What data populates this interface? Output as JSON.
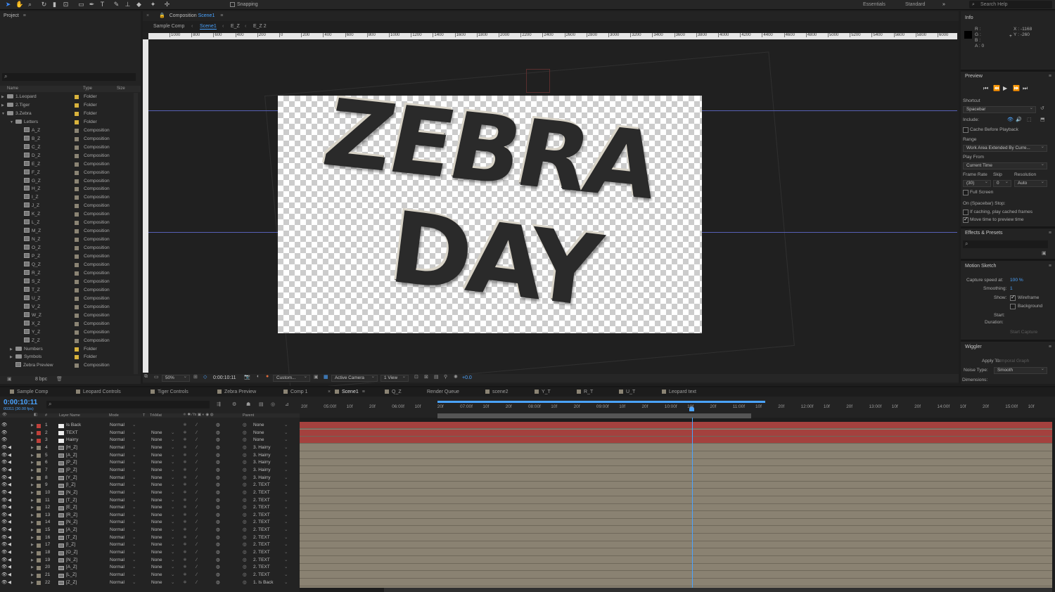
{
  "toolbar": {
    "snapping_label": "Snapping",
    "workspaces": [
      "Essentials",
      "Standard"
    ],
    "search_placeholder": "Search Help"
  },
  "project": {
    "title": "Project",
    "bpc": "8 bpc",
    "columns": {
      "name": "Name",
      "type": "Type",
      "size": "Size"
    },
    "items": [
      {
        "name": "1.Leopard",
        "type": "Folder",
        "level": 0,
        "kind": "folder",
        "open": false
      },
      {
        "name": "2.Tiger",
        "type": "Folder",
        "level": 0,
        "kind": "folder",
        "open": false
      },
      {
        "name": "3.Zebra",
        "type": "Folder",
        "level": 0,
        "kind": "folder",
        "open": true
      },
      {
        "name": "Letters",
        "type": "Folder",
        "level": 1,
        "kind": "folder",
        "open": true
      },
      {
        "name": "A_Z",
        "type": "Composition",
        "level": 2,
        "kind": "comp"
      },
      {
        "name": "B_Z",
        "type": "Composition",
        "level": 2,
        "kind": "comp"
      },
      {
        "name": "C_Z",
        "type": "Composition",
        "level": 2,
        "kind": "comp"
      },
      {
        "name": "D_Z",
        "type": "Composition",
        "level": 2,
        "kind": "comp"
      },
      {
        "name": "E_Z",
        "type": "Composition",
        "level": 2,
        "kind": "comp"
      },
      {
        "name": "F_Z",
        "type": "Composition",
        "level": 2,
        "kind": "comp"
      },
      {
        "name": "G_Z",
        "type": "Composition",
        "level": 2,
        "kind": "comp"
      },
      {
        "name": "H_Z",
        "type": "Composition",
        "level": 2,
        "kind": "comp"
      },
      {
        "name": "I_Z",
        "type": "Composition",
        "level": 2,
        "kind": "comp"
      },
      {
        "name": "J_Z",
        "type": "Composition",
        "level": 2,
        "kind": "comp"
      },
      {
        "name": "K_Z",
        "type": "Composition",
        "level": 2,
        "kind": "comp"
      },
      {
        "name": "L_Z",
        "type": "Composition",
        "level": 2,
        "kind": "comp"
      },
      {
        "name": "M_Z",
        "type": "Composition",
        "level": 2,
        "kind": "comp"
      },
      {
        "name": "N_Z",
        "type": "Composition",
        "level": 2,
        "kind": "comp"
      },
      {
        "name": "O_Z",
        "type": "Composition",
        "level": 2,
        "kind": "comp"
      },
      {
        "name": "P_Z",
        "type": "Composition",
        "level": 2,
        "kind": "comp"
      },
      {
        "name": "Q_Z",
        "type": "Composition",
        "level": 2,
        "kind": "comp"
      },
      {
        "name": "R_Z",
        "type": "Composition",
        "level": 2,
        "kind": "comp"
      },
      {
        "name": "S_Z",
        "type": "Composition",
        "level": 2,
        "kind": "comp"
      },
      {
        "name": "T_Z",
        "type": "Composition",
        "level": 2,
        "kind": "comp"
      },
      {
        "name": "U_Z",
        "type": "Composition",
        "level": 2,
        "kind": "comp"
      },
      {
        "name": "V_Z",
        "type": "Composition",
        "level": 2,
        "kind": "comp"
      },
      {
        "name": "W_Z",
        "type": "Composition",
        "level": 2,
        "kind": "comp"
      },
      {
        "name": "X_Z",
        "type": "Composition",
        "level": 2,
        "kind": "comp"
      },
      {
        "name": "Y_Z",
        "type": "Composition",
        "level": 2,
        "kind": "comp"
      },
      {
        "name": "Z_Z",
        "type": "Composition",
        "level": 2,
        "kind": "comp"
      },
      {
        "name": "Numbers",
        "type": "Folder",
        "level": 1,
        "kind": "folder",
        "open": false
      },
      {
        "name": "Symbols",
        "type": "Folder",
        "level": 1,
        "kind": "folder",
        "open": false
      },
      {
        "name": "Zebra Preview",
        "type": "Composition",
        "level": 1,
        "kind": "comp"
      }
    ]
  },
  "viewer": {
    "title_prefix": "Composition",
    "title_comp": "Scene1",
    "breadcrumbs": [
      "Sample Comp",
      "Scene1",
      "E_Z",
      "E_Z 2"
    ],
    "ruler_ticks": [
      "1000",
      "800",
      "600",
      "400",
      "200",
      "0",
      "200",
      "400",
      "600",
      "800",
      "1000",
      "1200",
      "1400",
      "1600",
      "1800",
      "2000",
      "2200",
      "2400",
      "2600",
      "2800",
      "3000",
      "3200",
      "3400",
      "3600",
      "3800",
      "4000",
      "4200",
      "4400",
      "4600",
      "4800",
      "5000",
      "5200",
      "5400",
      "5600",
      "5800",
      "6000"
    ],
    "canvas_line1": "ZEBRA",
    "canvas_line2": "DAY",
    "zoom": "50%",
    "timecode": "0:00:10:11",
    "resolution": "Custom...",
    "camera": "Active Camera",
    "views": "1 View",
    "exposure": "+0.0"
  },
  "info": {
    "title": "Info",
    "r": "R :",
    "g": "G :",
    "b": "B :",
    "a": "A : 0",
    "x": "X : -1168",
    "y": "Y : -260"
  },
  "preview": {
    "title": "Preview",
    "shortcut_label": "Shortcut",
    "shortcut": "Spacebar",
    "include_label": "Include:",
    "cache_label": "Cache Before Playback",
    "range_label": "Range",
    "range": "Work Area Extended By Curre...",
    "play_from_label": "Play From",
    "play_from": "Current Time",
    "frame_rate_label": "Frame Rate",
    "skip_label": "Skip",
    "resolution_label": "Resolution",
    "frame_rate": "(30)",
    "skip": "0",
    "resolution": "Auto",
    "full_screen_label": "Full Screen",
    "stop_label": "On (Spacebar) Stop:",
    "if_caching_label": "If caching, play cached frames",
    "move_time_label": "Move time to preview time"
  },
  "effects": {
    "title": "Effects & Presets"
  },
  "motion_sketch": {
    "title": "Motion Sketch",
    "capture_label": "Capture speed at:",
    "capture_value": "100 %",
    "smoothing_label": "Smoothing:",
    "smoothing_value": "1",
    "show_label": "Show:",
    "wireframe_label": "Wireframe",
    "background_label": "Background",
    "start_label": "Start:",
    "duration_label": "Duration:",
    "start_capture": "Start Capture"
  },
  "wiggler": {
    "title": "Wiggler",
    "apply_label": "Apply To:",
    "apply_value": "Temporal Graph",
    "noise_label": "Noise Type:",
    "noise_value": "Smooth",
    "dimensions_label": "Dimensions:"
  },
  "timeline": {
    "tabs": [
      "Sample Comp",
      "Leopard Controls",
      "Tiger Controls",
      "Zebra Preview",
      "Comp 1",
      "Scene1",
      "Q_Z",
      "Render Queue",
      "scene2",
      "Y_T",
      "R_T",
      "U_T",
      "Leopard text"
    ],
    "active_tab": "Scene1",
    "timecode": "0:00:10:11",
    "frame_info": "00311 (30.00 fps)",
    "columns": {
      "num": "#",
      "name": "Layer Name",
      "mode": "Mode",
      "t": "T",
      "trkmat": "TrkMat",
      "parent": "Parent"
    },
    "ruler": [
      "20f",
      "05:00f",
      "10f",
      "20f",
      "06:00f",
      "10f",
      "20f",
      "07:00f",
      "10f",
      "20f",
      "08:00f",
      "10f",
      "20f",
      "09:00f",
      "10f",
      "20f",
      "10:00f",
      "10f",
      "20f",
      "11:00f",
      "10f",
      "20f",
      "12:00f",
      "10f",
      "20f",
      "13:00f",
      "10f",
      "20f",
      "14:00f",
      "10f",
      "20f",
      "15:00f",
      "10f"
    ],
    "layers": [
      {
        "n": "1",
        "name": "Is Back",
        "mode": "Normal",
        "trk": "",
        "parent": "None",
        "color": "#c0413b",
        "icon": "solid"
      },
      {
        "n": "2",
        "name": "TEXT",
        "mode": "Normal",
        "trk": "None",
        "parent": "None",
        "color": "#c0413b",
        "icon": "solid"
      },
      {
        "n": "3",
        "name": "Hairry",
        "mode": "Normal",
        "trk": "None",
        "parent": "None",
        "color": "#c0413b",
        "icon": "solid"
      },
      {
        "n": "4",
        "name": "[H_Z]",
        "mode": "Normal",
        "trk": "None",
        "parent": "3. Hairry",
        "color": "#8b8474",
        "icon": "comp"
      },
      {
        "n": "5",
        "name": "[A_Z]",
        "mode": "Normal",
        "trk": "None",
        "parent": "3. Hairry",
        "color": "#8b8474",
        "icon": "comp"
      },
      {
        "n": "6",
        "name": "[P_Z]",
        "mode": "Normal",
        "trk": "None",
        "parent": "3. Hairry",
        "color": "#8b8474",
        "icon": "comp"
      },
      {
        "n": "7",
        "name": "[P_Z]",
        "mode": "Normal",
        "trk": "None",
        "parent": "3. Hairry",
        "color": "#8b8474",
        "icon": "comp"
      },
      {
        "n": "8",
        "name": "[Y_Z]",
        "mode": "Normal",
        "trk": "None",
        "parent": "3. Hairry",
        "color": "#8b8474",
        "icon": "comp"
      },
      {
        "n": "9",
        "name": "[I_Z]",
        "mode": "Normal",
        "trk": "None",
        "parent": "2. TEXT",
        "color": "#8b8474",
        "icon": "comp"
      },
      {
        "n": "10",
        "name": "[N_Z]",
        "mode": "Normal",
        "trk": "None",
        "parent": "2. TEXT",
        "color": "#8b8474",
        "icon": "comp"
      },
      {
        "n": "11",
        "name": "[T_Z]",
        "mode": "Normal",
        "trk": "None",
        "parent": "2. TEXT",
        "color": "#8b8474",
        "icon": "comp"
      },
      {
        "n": "12",
        "name": "[E_Z]",
        "mode": "Normal",
        "trk": "None",
        "parent": "2. TEXT",
        "color": "#8b8474",
        "icon": "comp"
      },
      {
        "n": "13",
        "name": "[R_Z]",
        "mode": "Normal",
        "trk": "None",
        "parent": "2. TEXT",
        "color": "#8b8474",
        "icon": "comp"
      },
      {
        "n": "14",
        "name": "[N_Z]",
        "mode": "Normal",
        "trk": "None",
        "parent": "2. TEXT",
        "color": "#8b8474",
        "icon": "comp"
      },
      {
        "n": "15",
        "name": "[A_Z]",
        "mode": "Normal",
        "trk": "None",
        "parent": "2. TEXT",
        "color": "#8b8474",
        "icon": "comp"
      },
      {
        "n": "16",
        "name": "[T_Z]",
        "mode": "Normal",
        "trk": "None",
        "parent": "2. TEXT",
        "color": "#8b8474",
        "icon": "comp"
      },
      {
        "n": "17",
        "name": "[I_Z]",
        "mode": "Normal",
        "trk": "None",
        "parent": "2. TEXT",
        "color": "#8b8474",
        "icon": "comp"
      },
      {
        "n": "18",
        "name": "[O_Z]",
        "mode": "Normal",
        "trk": "None",
        "parent": "2. TEXT",
        "color": "#8b8474",
        "icon": "comp"
      },
      {
        "n": "19",
        "name": "[N_Z]",
        "mode": "Normal",
        "trk": "None",
        "parent": "2. TEXT",
        "color": "#8b8474",
        "icon": "comp"
      },
      {
        "n": "20",
        "name": "[A_Z]",
        "mode": "Normal",
        "trk": "None",
        "parent": "2. TEXT",
        "color": "#8b8474",
        "icon": "comp"
      },
      {
        "n": "21",
        "name": "[L_Z]",
        "mode": "Normal",
        "trk": "None",
        "parent": "2. TEXT",
        "color": "#8b8474",
        "icon": "comp"
      },
      {
        "n": "22",
        "name": "[Z_Z]",
        "mode": "Normal",
        "trk": "None",
        "parent": "1. Is Back",
        "color": "#8b8474",
        "icon": "comp"
      }
    ]
  },
  "colors": {
    "accent": "#3d8cff",
    "playhead": "#4aa3ff",
    "track_red": "#a4413e",
    "track_tan": "#8a8272"
  }
}
